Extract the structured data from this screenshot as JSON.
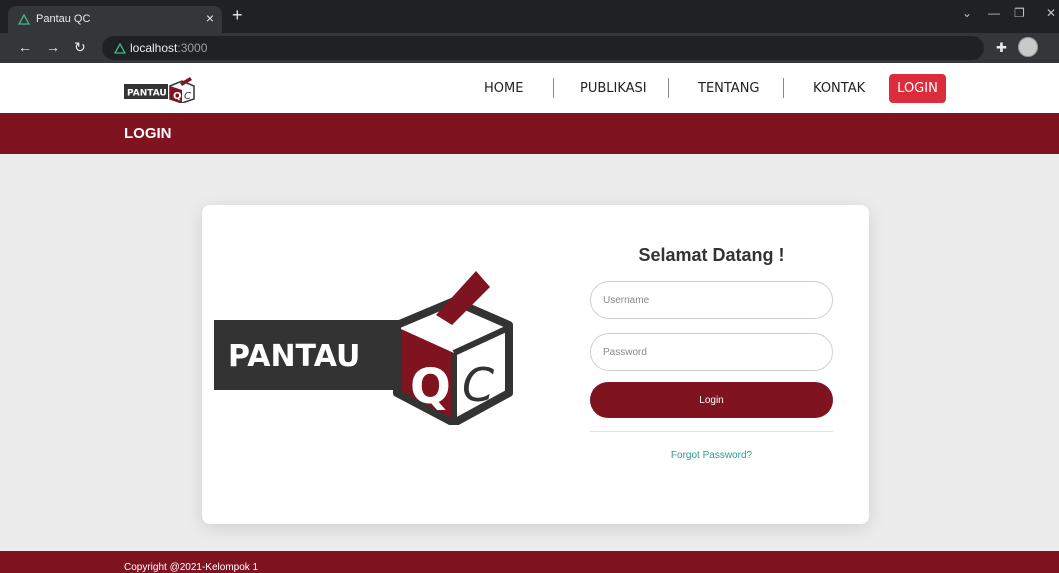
{
  "browser": {
    "tab_title": "Pantau QC",
    "tab_close": "×",
    "new_tab": "+",
    "url_host": "localhost",
    "url_port": ":3000"
  },
  "header": {
    "logo_text": "PANTAU",
    "nav": [
      {
        "label": "HOME"
      },
      {
        "label": "PUBLIKASI"
      },
      {
        "label": "TENTANG"
      },
      {
        "label": "KONTAK"
      }
    ],
    "login_label": "LOGIN"
  },
  "page": {
    "title": "LOGIN"
  },
  "login_card": {
    "logo_text": "PANTAU",
    "welcome": "Selamat Datang !",
    "username_placeholder": "Username",
    "password_placeholder": "Password",
    "login_button": "Login",
    "forgot_password": "Forgot Password?"
  },
  "footer": {
    "copyright": "Copyright @2021-Kelompok 1"
  },
  "colors": {
    "brand": "#801320",
    "nav_login": "#dc2c3b",
    "link": "#2a9d8f",
    "background": "#ececec"
  }
}
